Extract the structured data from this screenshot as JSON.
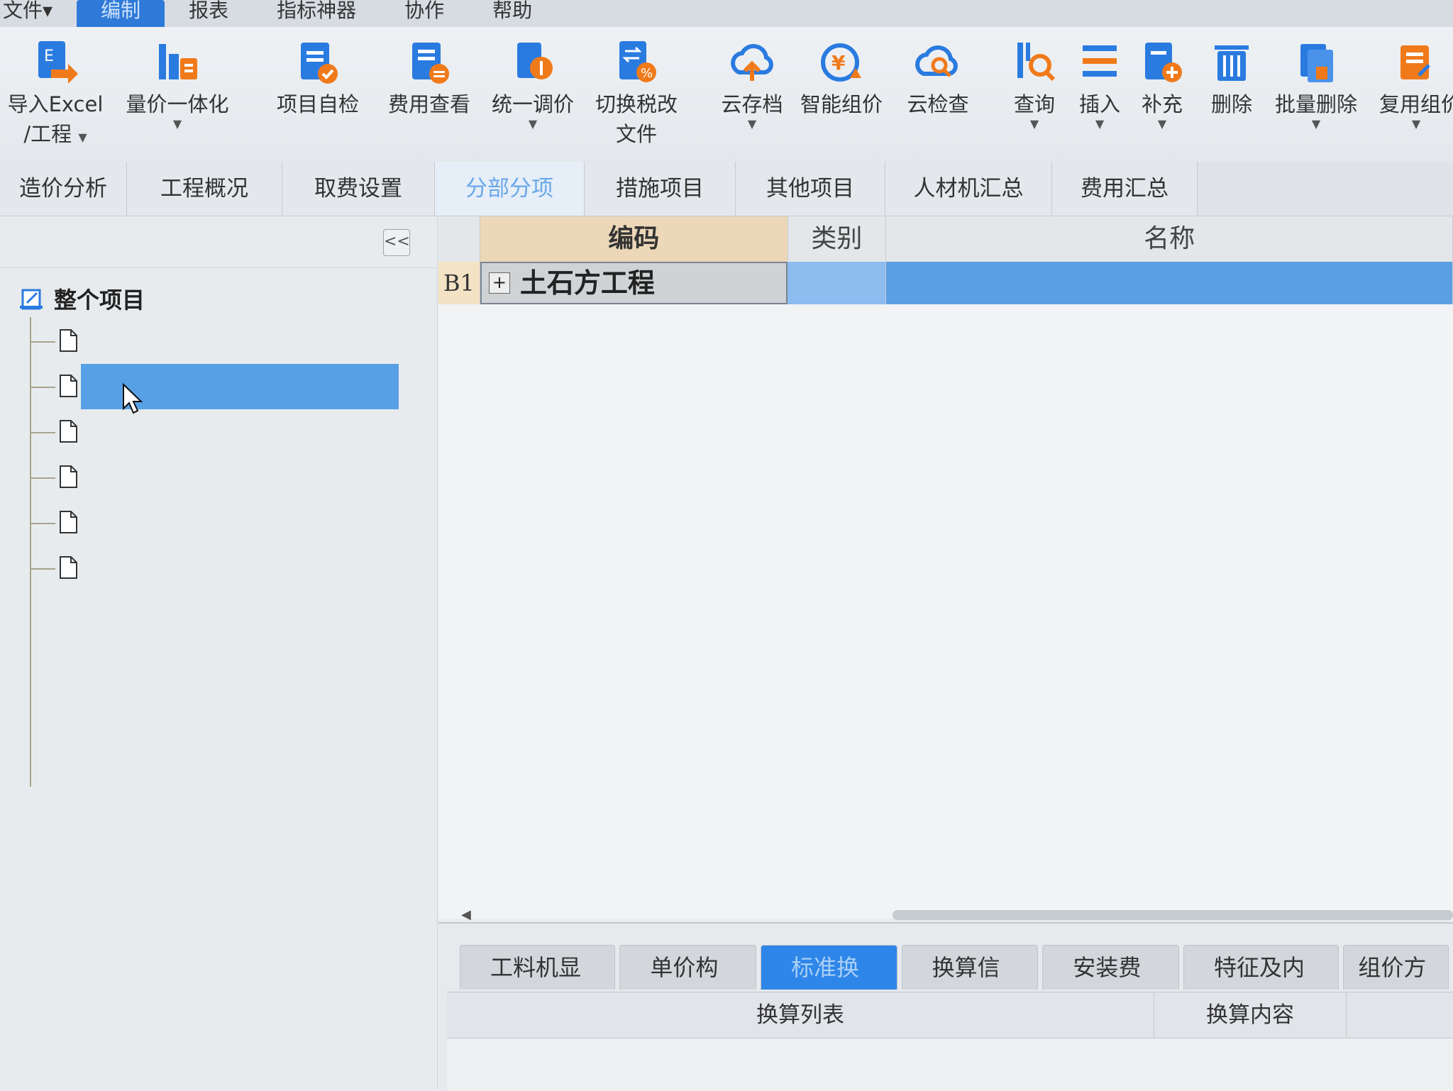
{
  "menu": {
    "items": [
      "文件▾",
      "编制",
      "报表",
      "指标神器",
      "协作",
      "帮助"
    ],
    "active_index": 1
  },
  "toolbar": {
    "import_excel_line1": "导入Excel",
    "import_excel_line2": "/工程",
    "quantity_price": "量价一体化",
    "self_check": "项目自检",
    "cost_view": "费用查看",
    "unified_price": "统一调价",
    "switch_tax_line1": "切换税改",
    "switch_tax_line2": "文件",
    "cloud_archive": "云存档",
    "smart_pricing": "智能组价",
    "cloud_check": "云检查",
    "query": "查询",
    "insert": "插入",
    "supplement": "补充",
    "delete": "删除",
    "batch_delete": "批量删除",
    "reuse_pricing": "复用组价"
  },
  "tabs": [
    "造价分析",
    "工程概况",
    "取费设置",
    "分部分项",
    "措施项目",
    "其他项目",
    "人材机汇总",
    "费用汇总"
  ],
  "active_tab": "分部分项",
  "tree": {
    "collapse_symbol": "<<",
    "root_label": "整个项目",
    "children_count": 6,
    "selected_index": 1
  },
  "grid": {
    "headers": {
      "code": "编码",
      "type": "类别",
      "name": "名称"
    },
    "rows": [
      {
        "rownum": "B1",
        "expand": "+",
        "code": "土石方工程",
        "type": "",
        "name": ""
      }
    ]
  },
  "bottom": {
    "tabs": [
      "工料机显示",
      "单价构成",
      "标准换算",
      "换算信息",
      "安装费用",
      "特征及内容",
      "组价方案"
    ],
    "active_tab": "标准换算",
    "headers": {
      "list": "换算列表",
      "content": "换算内容"
    }
  },
  "colors": {
    "accent": "#2f7ad8",
    "selection": "#5b9fe3",
    "icon_blue": "#2a7be0",
    "icon_orange": "#f07a1a"
  }
}
